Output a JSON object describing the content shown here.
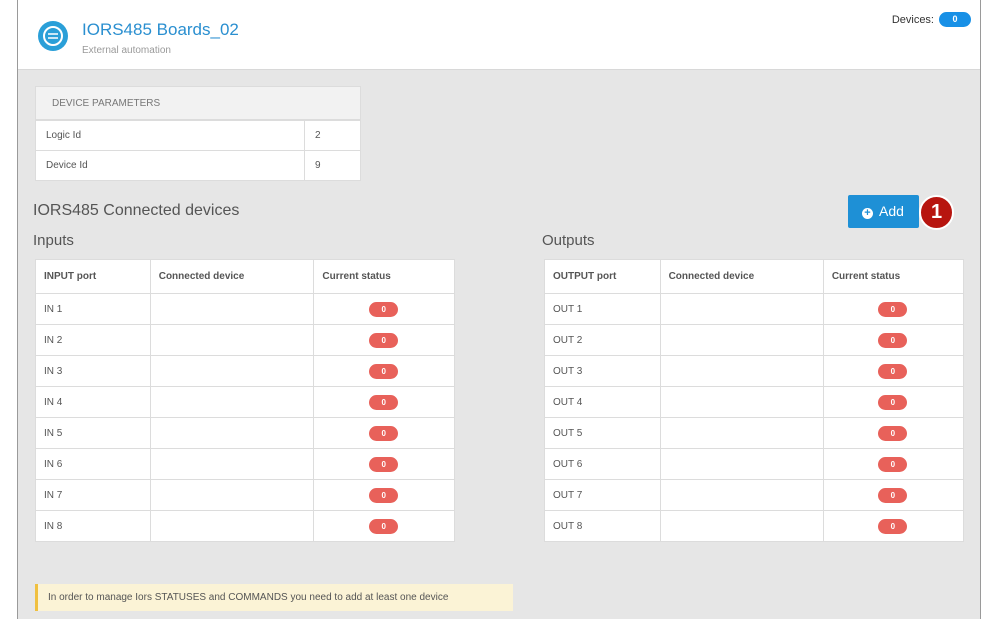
{
  "header": {
    "title": "IORS485 Boards_02",
    "subtitle": "External automation",
    "devices_label": "Devices:",
    "devices_count": "0",
    "icon": "board-icon"
  },
  "params": {
    "title": "DEVICE PARAMETERS",
    "rows": [
      {
        "label": "Logic Id",
        "value": "2"
      },
      {
        "label": "Device Id",
        "value": "9"
      }
    ]
  },
  "connected": {
    "title": "IORS485 Connected devices",
    "add_label": "Add",
    "callout": "1"
  },
  "inputs": {
    "title": "Inputs",
    "headers": [
      "INPUT port",
      "Connected device",
      "Current status"
    ],
    "rows": [
      {
        "port": "IN 1",
        "device": "",
        "status": "0"
      },
      {
        "port": "IN 2",
        "device": "",
        "status": "0"
      },
      {
        "port": "IN 3",
        "device": "",
        "status": "0"
      },
      {
        "port": "IN 4",
        "device": "",
        "status": "0"
      },
      {
        "port": "IN 5",
        "device": "",
        "status": "0"
      },
      {
        "port": "IN 6",
        "device": "",
        "status": "0"
      },
      {
        "port": "IN 7",
        "device": "",
        "status": "0"
      },
      {
        "port": "IN 8",
        "device": "",
        "status": "0"
      }
    ]
  },
  "outputs": {
    "title": "Outputs",
    "headers": [
      "OUTPUT port",
      "Connected device",
      "Current status"
    ],
    "rows": [
      {
        "port": "OUT 1",
        "device": "",
        "status": "0"
      },
      {
        "port": "OUT 2",
        "device": "",
        "status": "0"
      },
      {
        "port": "OUT 3",
        "device": "",
        "status": "0"
      },
      {
        "port": "OUT 4",
        "device": "",
        "status": "0"
      },
      {
        "port": "OUT 5",
        "device": "",
        "status": "0"
      },
      {
        "port": "OUT 6",
        "device": "",
        "status": "0"
      },
      {
        "port": "OUT 7",
        "device": "",
        "status": "0"
      },
      {
        "port": "OUT 8",
        "device": "",
        "status": "0"
      }
    ]
  },
  "notice": "In order to manage Iors STATUSES and COMMANDS you need to add at least one device",
  "colors": {
    "accent": "#1e90d6",
    "status_off": "#e8615a",
    "callout": "#b7150f",
    "notice_bg": "#fbf3d6"
  }
}
